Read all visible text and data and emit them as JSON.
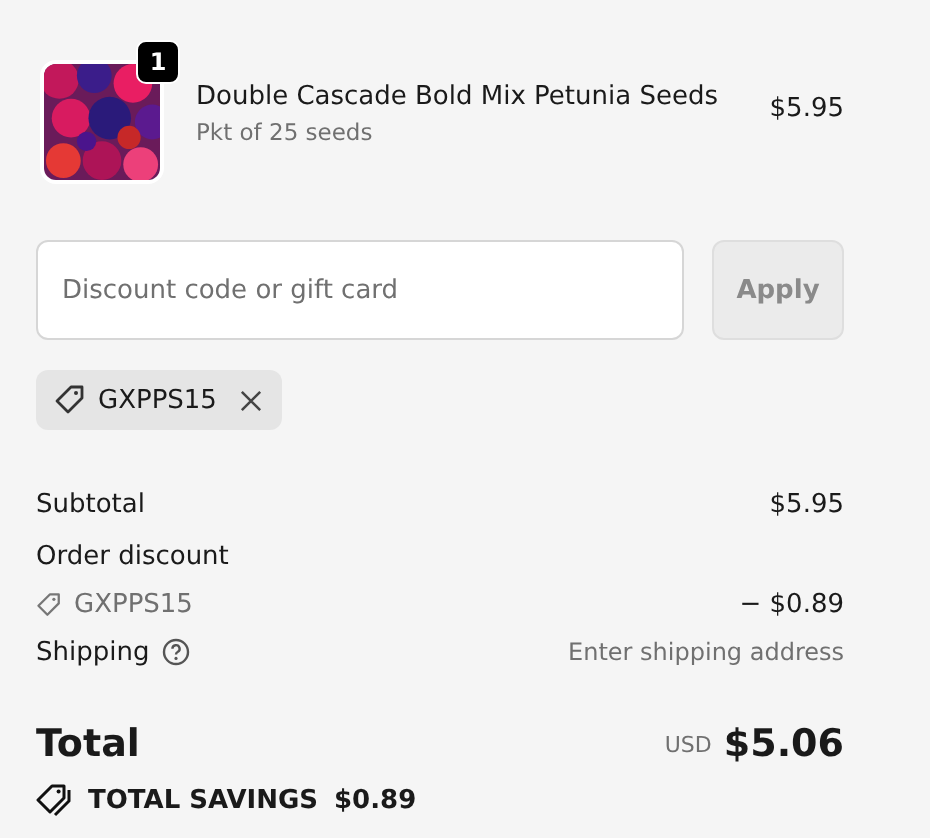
{
  "line_item": {
    "quantity": "1",
    "name": "Double Cascade Bold Mix Petunia Seeds",
    "variant": "Pkt of 25 seeds",
    "price": "$5.95"
  },
  "discount": {
    "placeholder": "Discount code or gift card",
    "apply": "Apply",
    "apply_disabled": true
  },
  "applied_codes": [
    {
      "code": "GXPPS15"
    }
  ],
  "summary": {
    "subtotal_label": "Subtotal",
    "subtotal": "$5.95",
    "discount_label": "Order discount",
    "discount_code": "GXPPS15",
    "discount_amount": "− $0.89",
    "shipping_label": "Shipping",
    "shipping_value": "Enter shipping address",
    "total_label": "Total",
    "currency": "USD",
    "total": "$5.06",
    "savings_label": "TOTAL SAVINGS",
    "savings": "$0.89"
  }
}
